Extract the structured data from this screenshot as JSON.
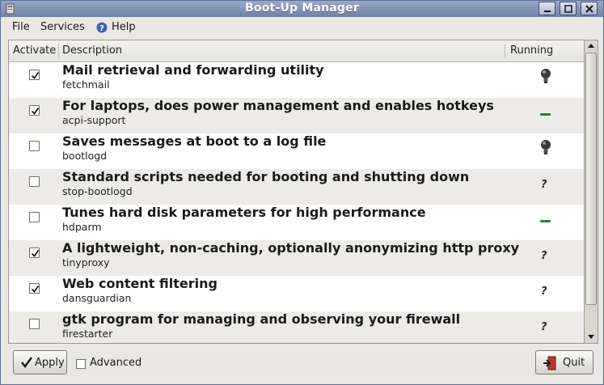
{
  "window": {
    "title": "Boot-Up Manager"
  },
  "menubar": {
    "file": "File",
    "services": "Services",
    "help": "Help"
  },
  "table": {
    "columns": {
      "activate": "Activate",
      "description": "Description",
      "running": "Running"
    },
    "rows": [
      {
        "description": "Mail retrieval and forwarding utility",
        "service": "fetchmail",
        "active": true,
        "running": "bulb-icon"
      },
      {
        "description": "For laptops, does  power management and enables hotkeys",
        "service": "acpi-support",
        "active": true,
        "running": "dash-icon"
      },
      {
        "description": "Saves messages at boot to a log file",
        "service": "bootlogd",
        "active": false,
        "running": "bulb-icon"
      },
      {
        "description": "Standard scripts needed for booting and shutting down",
        "service": "stop-bootlogd",
        "active": false,
        "running": "?"
      },
      {
        "description": "Tunes hard disk parameters for high performance",
        "service": "hdparm",
        "active": false,
        "running": "dash-icon"
      },
      {
        "description": "A lightweight, non-caching, optionally anonymizing http proxy",
        "service": "tinyproxy",
        "active": true,
        "running": "?"
      },
      {
        "description": "Web content filtering",
        "service": "dansguardian",
        "active": true,
        "running": "?"
      },
      {
        "description": "gtk program for managing and observing your firewall",
        "service": "firestarter",
        "active": false,
        "running": "?"
      }
    ]
  },
  "footer": {
    "apply_label": "Apply",
    "advanced_label": "Advanced",
    "advanced_checked": false,
    "quit_label": "Quit"
  },
  "colors": {
    "titlebar": "#7f90b5",
    "dash": "#2e7d32",
    "row_alt": "#ecebe7"
  }
}
